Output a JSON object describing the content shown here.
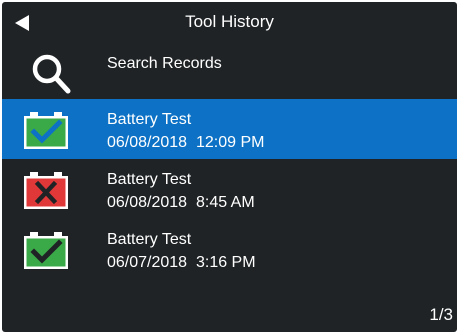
{
  "header": {
    "title": "Tool History",
    "back_icon": "back-arrow-icon"
  },
  "search": {
    "label": "Search Records",
    "icon": "search-icon"
  },
  "colors": {
    "background": "#1f2325",
    "selected": "#0d72c6",
    "pass": "#3aa947",
    "fail": "#e03838"
  },
  "records": [
    {
      "title": "Battery Test",
      "date": "06/08/2018",
      "time": "12:09 PM",
      "status": "pass",
      "selected": true
    },
    {
      "title": "Battery Test",
      "date": "06/08/2018",
      "time": "8:45 AM",
      "status": "fail",
      "selected": false
    },
    {
      "title": "Battery Test",
      "date": "06/07/2018",
      "time": "3:16 PM",
      "status": "pass",
      "selected": false
    }
  ],
  "pagination": {
    "label": "1/3",
    "current": 1,
    "total": 3
  }
}
